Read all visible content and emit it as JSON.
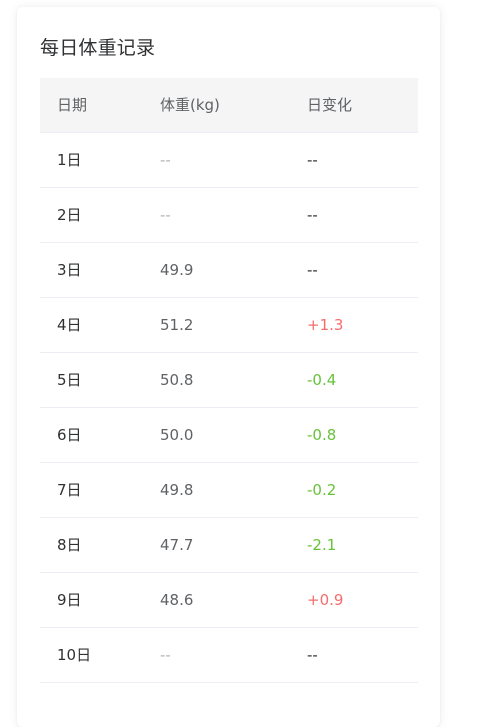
{
  "card": {
    "title": "每日体重记录"
  },
  "table": {
    "headers": [
      "日期",
      "体重(kg)",
      "日变化"
    ],
    "rows": [
      {
        "date": "1日",
        "weight": "--",
        "change": "--",
        "weight_state": "muted",
        "change_state": "dark"
      },
      {
        "date": "2日",
        "weight": "--",
        "change": "--",
        "weight_state": "muted",
        "change_state": "dark"
      },
      {
        "date": "3日",
        "weight": "49.9",
        "change": "--",
        "weight_state": "normal",
        "change_state": "dark"
      },
      {
        "date": "4日",
        "weight": "51.2",
        "change": "+1.3",
        "weight_state": "normal",
        "change_state": "up"
      },
      {
        "date": "5日",
        "weight": "50.8",
        "change": "-0.4",
        "weight_state": "normal",
        "change_state": "down"
      },
      {
        "date": "6日",
        "weight": "50.0",
        "change": "-0.8",
        "weight_state": "normal",
        "change_state": "down"
      },
      {
        "date": "7日",
        "weight": "49.8",
        "change": "-0.2",
        "weight_state": "normal",
        "change_state": "down"
      },
      {
        "date": "8日",
        "weight": "47.7",
        "change": "-2.1",
        "weight_state": "normal",
        "change_state": "down"
      },
      {
        "date": "9日",
        "weight": "48.6",
        "change": "+0.9",
        "weight_state": "normal",
        "change_state": "up"
      },
      {
        "date": "10日",
        "weight": "--",
        "change": "--",
        "weight_state": "muted",
        "change_state": "dark"
      }
    ]
  },
  "colors": {
    "increase": "#f56c6c",
    "decrease": "#67c23a",
    "header_bg": "#f5f5f5",
    "border": "#ebeef5"
  }
}
